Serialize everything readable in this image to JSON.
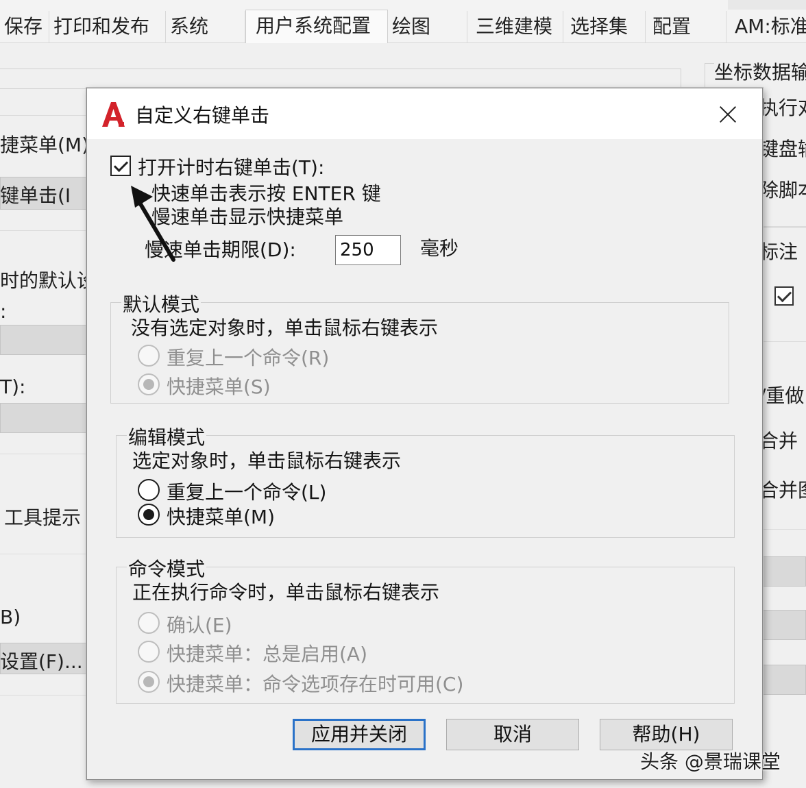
{
  "tabs": [
    {
      "label": "保存",
      "active": false
    },
    {
      "label": "打印和发布",
      "active": false
    },
    {
      "label": "系统",
      "active": false
    },
    {
      "label": "用户系统配置",
      "active": true
    },
    {
      "label": "绘图",
      "active": false
    },
    {
      "label": "三维建模",
      "active": false
    },
    {
      "label": "选择集",
      "active": false
    },
    {
      "label": "配置",
      "active": false
    },
    {
      "label": "AM:标准",
      "active": false
    }
  ],
  "background": {
    "left_texts": [
      "捷菜单(M)",
      "键单击(I",
      "时的默认设",
      ":",
      "T):",
      "工具提示",
      "B)",
      "设置(F)..."
    ],
    "right_texts": [
      "坐标数据输",
      "执行对",
      "键盘输",
      "除脚本",
      "标注",
      "/重做",
      "合并",
      "合并图"
    ]
  },
  "dialog": {
    "title": "自定义右键单击",
    "icon_letter": "A",
    "timed_checkbox": {
      "label": "打开计时右键单击(T):",
      "checked": true
    },
    "quick_click_desc": "快速单击表示按 ENTER 键",
    "slow_click_desc": "慢速单击显示快捷菜单",
    "duration": {
      "label": "慢速单击期限(D):",
      "value": "250",
      "unit": "毫秒"
    },
    "default_mode": {
      "title": "默认模式",
      "desc": "没有选定对象时，单击鼠标右键表示",
      "options": [
        {
          "label": "重复上一个命令(R)",
          "selected": false,
          "enabled": false
        },
        {
          "label": "快捷菜单(S)",
          "selected": true,
          "enabled": false
        }
      ]
    },
    "edit_mode": {
      "title": "编辑模式",
      "desc": "选定对象时，单击鼠标右键表示",
      "options": [
        {
          "label": "重复上一个命令(L)",
          "selected": false,
          "enabled": true
        },
        {
          "label": "快捷菜单(M)",
          "selected": true,
          "enabled": true
        }
      ]
    },
    "command_mode": {
      "title": "命令模式",
      "desc": "正在执行命令时，单击鼠标右键表示",
      "options": [
        {
          "label": "确认(E)",
          "selected": false,
          "enabled": false
        },
        {
          "label": "快捷菜单：总是启用(A)",
          "selected": false,
          "enabled": false
        },
        {
          "label": "快捷菜单：命令选项存在时可用(C)",
          "selected": true,
          "enabled": false
        }
      ]
    },
    "buttons": {
      "apply": "应用并关闭",
      "cancel": "取消",
      "help": "帮助(H)"
    }
  },
  "watermark": "头条 @景瑞课堂",
  "colors": {
    "accent": "#2a72c8",
    "icon_red": "#d3222a",
    "disabled_text": "#8f8f8f"
  }
}
